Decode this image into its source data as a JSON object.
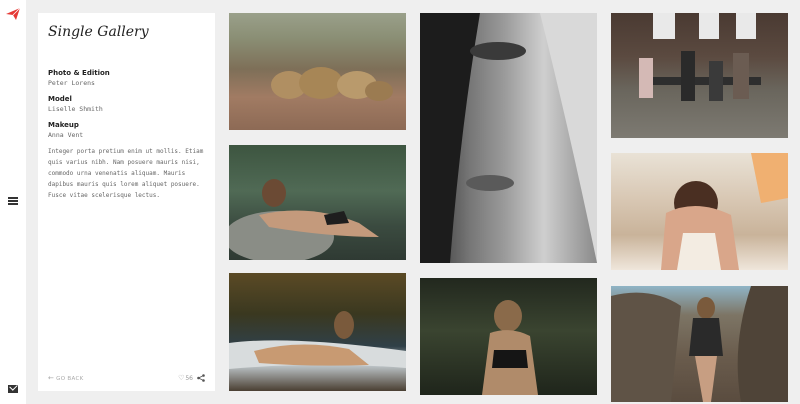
{
  "gallery": {
    "title": "Single Gallery",
    "credits": [
      {
        "label": "Photo & Edition",
        "value": "Peter Lorens"
      },
      {
        "label": "Model",
        "value": "Liselle Shmith"
      },
      {
        "label": "Makeup",
        "value": "Anna Vent"
      }
    ],
    "description": "Integer porta pretium enim ut mollis. Etiam quis varius nibh. Nam posuere mauris nisi, commodo urna venenatis aliquam. Mauris dapibus mauris quis lorem aliquet posuere. Fusce vitae scelerisque lectus.",
    "footer": {
      "back_label": "GO BACK",
      "likes": "56"
    }
  },
  "icons": {
    "logo": "paper-plane-logo-icon",
    "menu": "hamburger-menu-icon",
    "mail": "mail-icon",
    "back": "arrow-left-icon",
    "heart": "heart-icon",
    "share": "share-icon"
  },
  "colors": {
    "accent": "#e53935",
    "background": "#efefef",
    "card": "#ffffff"
  },
  "photos": [
    {
      "subject": "lions"
    },
    {
      "subject": "woman-lying-on-rock"
    },
    {
      "subject": "woman-on-beach"
    },
    {
      "subject": "close-up-face"
    },
    {
      "subject": "woman-in-forest"
    },
    {
      "subject": "group-on-bench"
    },
    {
      "subject": "woman-in-bathtub"
    },
    {
      "subject": "woman-among-rocks"
    }
  ]
}
